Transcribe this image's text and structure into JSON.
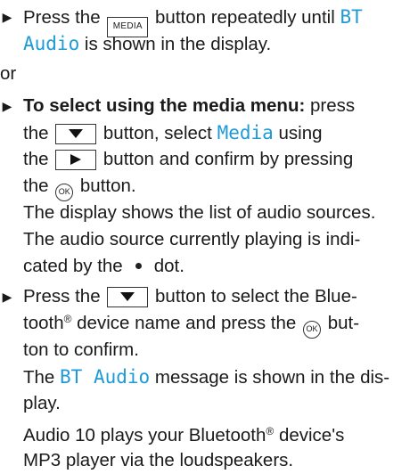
{
  "step1": {
    "line1": {
      "pre": "Press the",
      "key": "MEDIA",
      "mid": "button repeatedly until",
      "disp": "BT"
    },
    "line2": {
      "disp": "Audio",
      "post": "is shown in the display."
    }
  },
  "or": "or",
  "step2": {
    "line1": {
      "bold": "To select using the media menu:",
      "post": "press"
    },
    "line2": {
      "pre": "the",
      "post": "button, select",
      "disp": "Media",
      "end": "using"
    },
    "line3": {
      "pre": "the",
      "post": "button and confirm by pressing"
    },
    "line4": {
      "pre": "the",
      "ok": "OK",
      "post": "button."
    },
    "line5": "The display shows the list of audio sources.",
    "line6": "The audio source currently playing is indi-",
    "line7": {
      "pre": "cated by the",
      "post": "dot."
    }
  },
  "step3": {
    "line1": {
      "pre": "Press the",
      "post": "button to select the Blue-"
    },
    "line2": {
      "pre": "tooth",
      "reg": "®",
      "mid": "device name and press the",
      "ok": "OK",
      "post": "but-"
    },
    "line3": "ton to confirm.",
    "line4": {
      "pre": "The",
      "disp": "BT Audio",
      "post": "message is shown in the dis-"
    },
    "line5": "play.",
    "line6": {
      "pre": "Audio 10 plays your Bluetooth",
      "reg": "®",
      "post": "device's"
    },
    "line7": "MP3 player via the loudspeakers."
  },
  "icons": {
    "arrow_down": "down-triangle",
    "arrow_right": "right-triangle",
    "ok_button": "ok-circle",
    "dot": "filled-dot"
  },
  "colors": {
    "display_text": "#1e9bd7",
    "body_text": "#1a1a1a"
  }
}
